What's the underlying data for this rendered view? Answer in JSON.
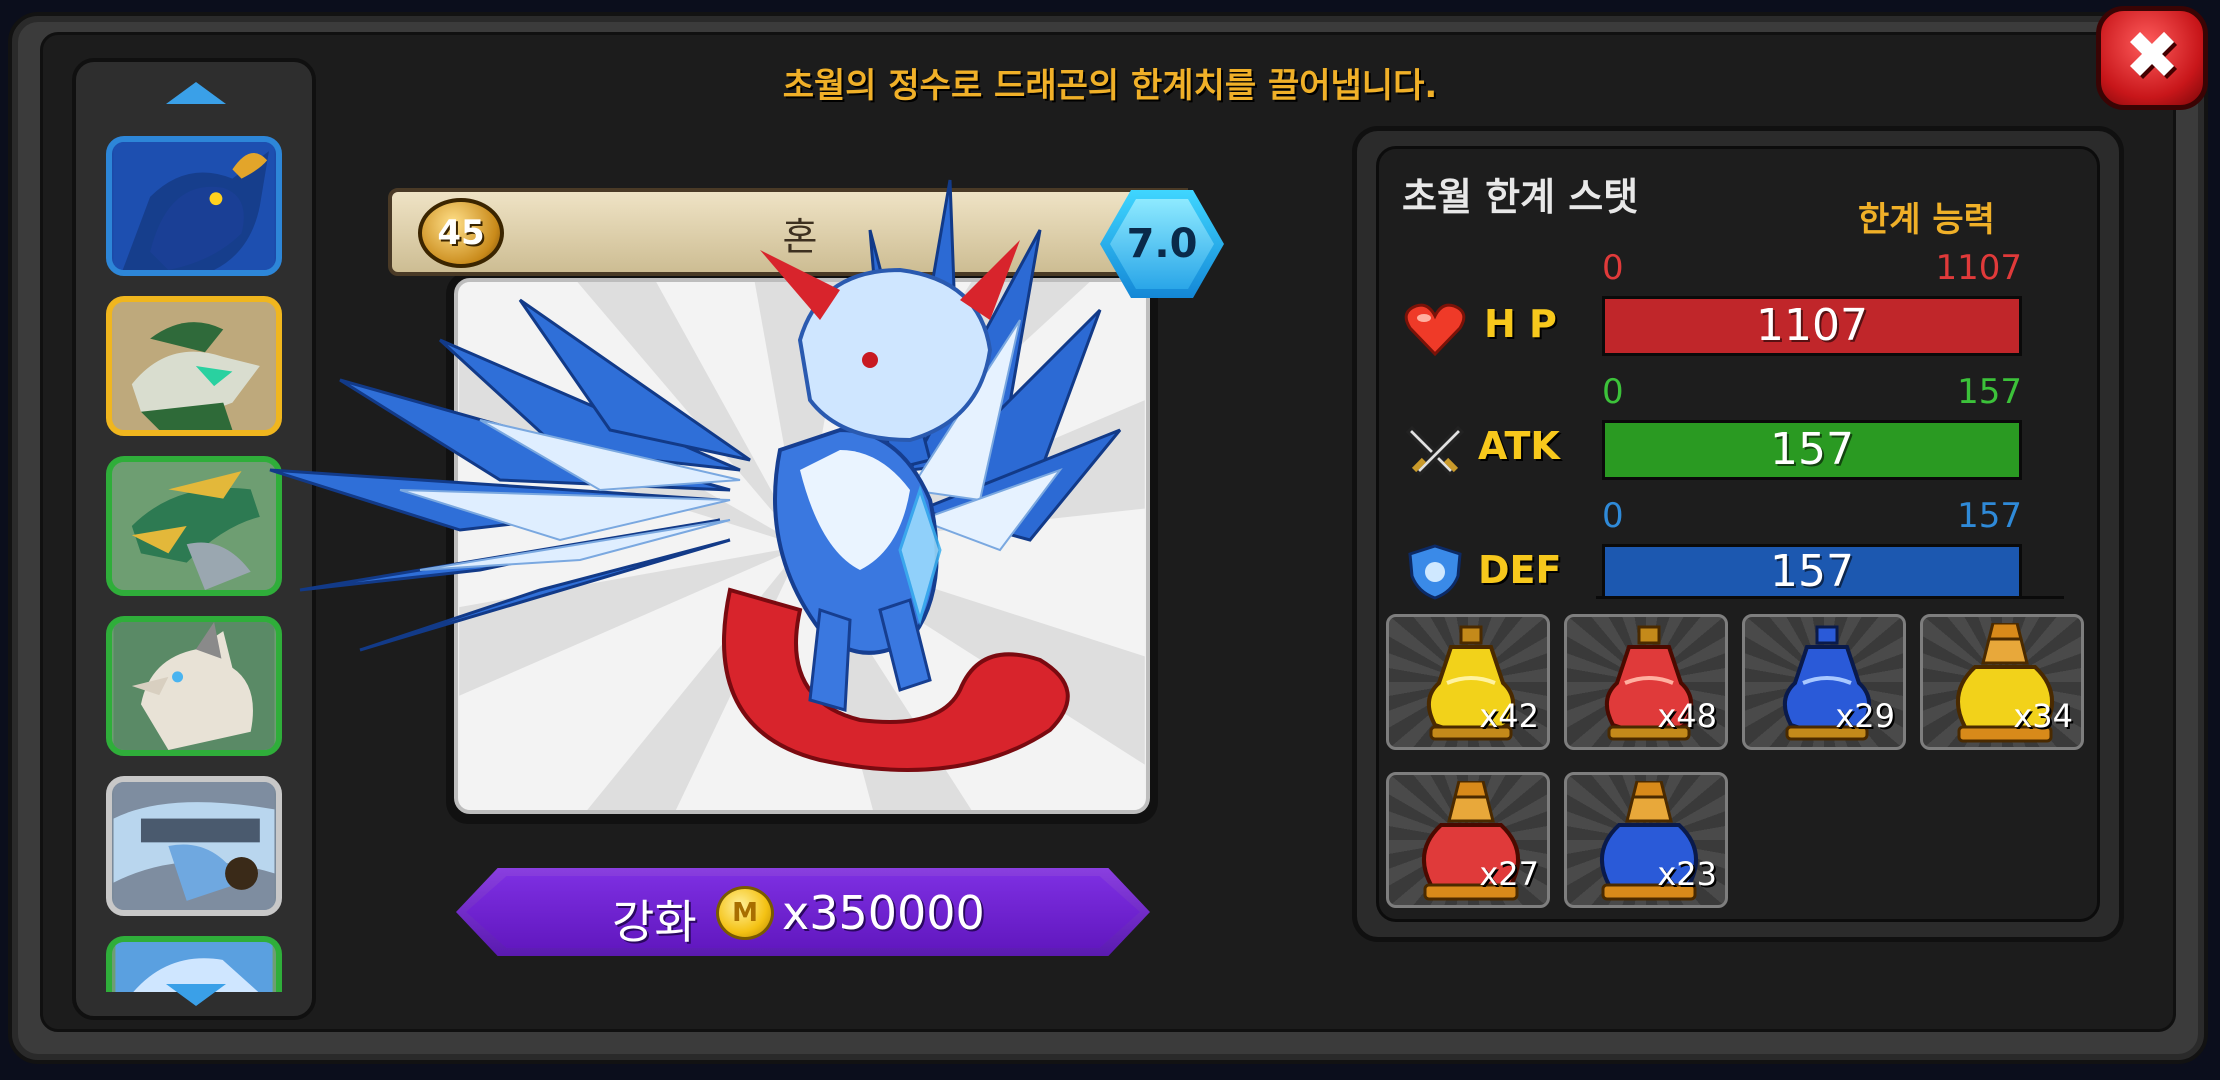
{
  "header": {
    "description": "초월의 정수로 드래곤의 한계치를 끌어냅니다."
  },
  "close_button": {
    "symbol": "✖"
  },
  "dragon_list": {
    "thumbnails": [
      {
        "name": "blue-dragon",
        "frame_color": "#2d86d8"
      },
      {
        "name": "gold-dragon",
        "frame_color": "#f0b61e"
      },
      {
        "name": "green-dragon",
        "frame_color": "#2fae3a"
      },
      {
        "name": "wolf-dragon",
        "frame_color": "#2fae3a"
      },
      {
        "name": "silver-dragon",
        "frame_color": "#c8c8c8"
      },
      {
        "name": "partial-dragon",
        "frame_color": "#2fae3a"
      }
    ]
  },
  "dragon": {
    "level": "45",
    "name": "혼",
    "grade": "7.0"
  },
  "upgrade": {
    "label": "강화",
    "coin_symbol": "M",
    "cost": "x350000"
  },
  "stats_panel": {
    "title": "초월 한계 스탯",
    "subtitle": "한계 능력",
    "stats": [
      {
        "label": "H P",
        "min": "0",
        "max": "1107",
        "value": "1107",
        "fill": 1.0,
        "color": "#c0262a",
        "min_color": "#e03a3a",
        "icon": "heart-icon"
      },
      {
        "label": "ATK",
        "min": "0",
        "max": "157",
        "value": "157",
        "fill": 1.0,
        "color": "#2a9a22",
        "min_color": "#3cc23a",
        "icon": "crossed-swords-icon"
      },
      {
        "label": "DEF",
        "min": "0",
        "max": "157",
        "value": "157",
        "fill": 1.0,
        "color": "#1c58b0",
        "min_color": "#2f8ad8",
        "icon": "shield-icon"
      }
    ]
  },
  "items": [
    {
      "count": "x42",
      "liquid": "#f2d21a",
      "type": "small-potion"
    },
    {
      "count": "x48",
      "liquid": "#e03a3a",
      "type": "small-potion"
    },
    {
      "count": "x29",
      "liquid": "#2a5ad8",
      "type": "small-potion"
    },
    {
      "count": "x34",
      "liquid": "#f2d21a",
      "type": "large-potion"
    },
    {
      "count": "x27",
      "liquid": "#e03a3a",
      "type": "large-potion"
    },
    {
      "count": "x23",
      "liquid": "#2a5ad8",
      "type": "large-potion"
    }
  ]
}
